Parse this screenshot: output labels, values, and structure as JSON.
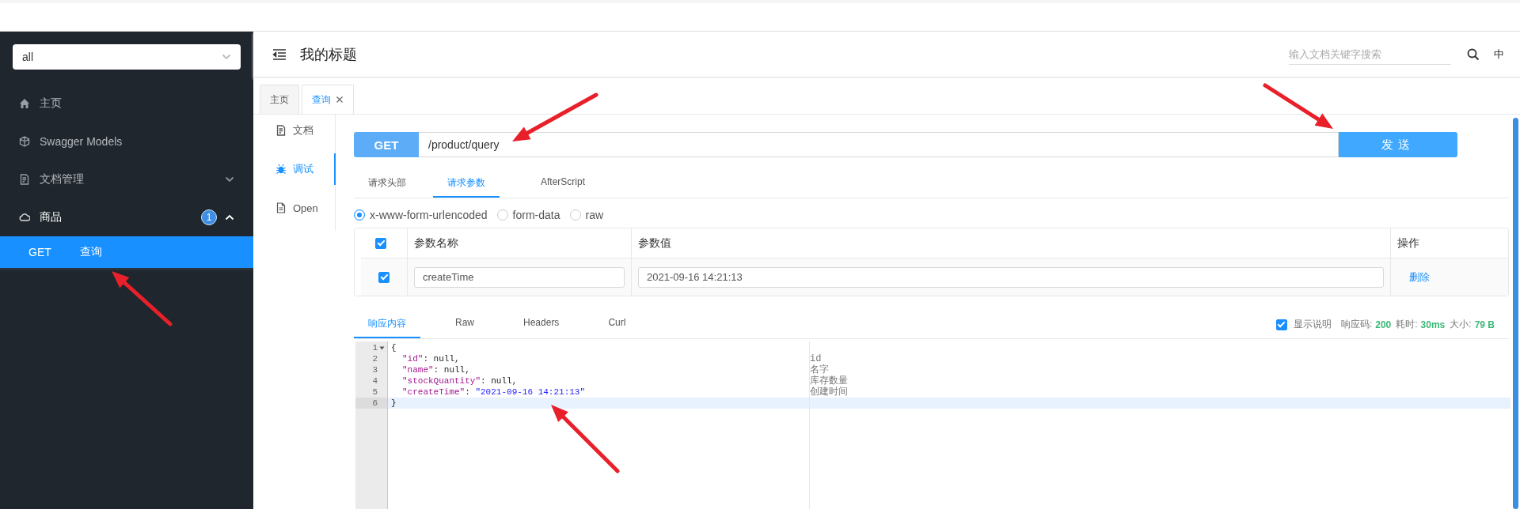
{
  "sidebar": {
    "select": {
      "value": "all"
    },
    "items": [
      {
        "kind": "home",
        "label": "主页"
      },
      {
        "kind": "cube",
        "label": "Swagger Models"
      },
      {
        "kind": "doc",
        "label": "文档管理",
        "expanded": false
      },
      {
        "kind": "cloud",
        "label": "商品",
        "badge": "1",
        "expanded": true,
        "children": [
          {
            "method": "GET",
            "label": "查询",
            "selected": true
          }
        ]
      }
    ]
  },
  "header": {
    "title": "我的标题",
    "search": {
      "placeholder": "输入文档关键字搜索"
    },
    "language": "中"
  },
  "tabs": [
    {
      "label": "主页",
      "selected": false,
      "closable": false
    },
    {
      "label": "查询",
      "selected": true,
      "closable": true
    }
  ],
  "side_nav": [
    {
      "kind": "doc",
      "label": "文档",
      "selected": false
    },
    {
      "kind": "bug",
      "label": "调试",
      "selected": true
    },
    {
      "kind": "file",
      "label": "Open",
      "selected": false
    }
  ],
  "request": {
    "method": "GET",
    "url": "/product/query",
    "send_label": "发送"
  },
  "request_tabs": [
    {
      "label": "请求头部",
      "selected": false
    },
    {
      "label": "请求参数",
      "selected": true
    },
    {
      "label": "AfterScript",
      "selected": false
    }
  ],
  "body_types": [
    {
      "label": "x-www-form-urlencoded",
      "selected": true
    },
    {
      "label": "form-data",
      "selected": false
    },
    {
      "label": "raw",
      "selected": false
    }
  ],
  "params": {
    "all_checked": true,
    "columns": [
      "参数名称",
      "参数值",
      "操作"
    ],
    "rows": [
      {
        "checked": true,
        "name": "createTime",
        "value": "2021-09-16 14:21:13",
        "action": "删除"
      }
    ]
  },
  "response_tabs": [
    {
      "label": "响应内容",
      "selected": true
    },
    {
      "label": "Raw",
      "selected": false
    },
    {
      "label": "Headers",
      "selected": false
    },
    {
      "label": "Curl",
      "selected": false
    }
  ],
  "response_meta": {
    "show_description": {
      "label": "显示说明",
      "checked": true
    },
    "stats": [
      {
        "label": "响应码:",
        "value": "200"
      },
      {
        "label": "耗时:",
        "value": "30ms"
      },
      {
        "label": "大小:",
        "value": "79 B"
      }
    ]
  },
  "editor": {
    "lines": [
      {
        "number": "1",
        "foldable": true,
        "indented": false,
        "active": false,
        "tokens": [
          {
            "kind": "punct",
            "text": "{"
          }
        ]
      },
      {
        "number": "2",
        "foldable": false,
        "indented": true,
        "active": false,
        "tokens": [
          {
            "kind": "key",
            "text": "\"id\""
          },
          {
            "kind": "punct",
            "text": ": null,"
          }
        ],
        "description": "id"
      },
      {
        "number": "3",
        "foldable": false,
        "indented": true,
        "active": false,
        "tokens": [
          {
            "kind": "key",
            "text": "\"name\""
          },
          {
            "kind": "punct",
            "text": ": null,"
          }
        ],
        "description": "名字"
      },
      {
        "number": "4",
        "foldable": false,
        "indented": true,
        "active": false,
        "tokens": [
          {
            "kind": "key",
            "text": "\"stockQuantity\""
          },
          {
            "kind": "punct",
            "text": ": null,"
          }
        ],
        "description": "库存数量"
      },
      {
        "number": "5",
        "foldable": false,
        "indented": true,
        "active": false,
        "tokens": [
          {
            "kind": "key",
            "text": "\"createTime\""
          },
          {
            "kind": "punct",
            "text": ": "
          },
          {
            "kind": "string",
            "text": "\"2021-09-16 14:21:13\""
          }
        ],
        "description": "创建时间"
      },
      {
        "number": "6",
        "foldable": false,
        "indented": false,
        "active": true,
        "tokens": [
          {
            "kind": "punct",
            "text": "}"
          }
        ]
      }
    ]
  }
}
